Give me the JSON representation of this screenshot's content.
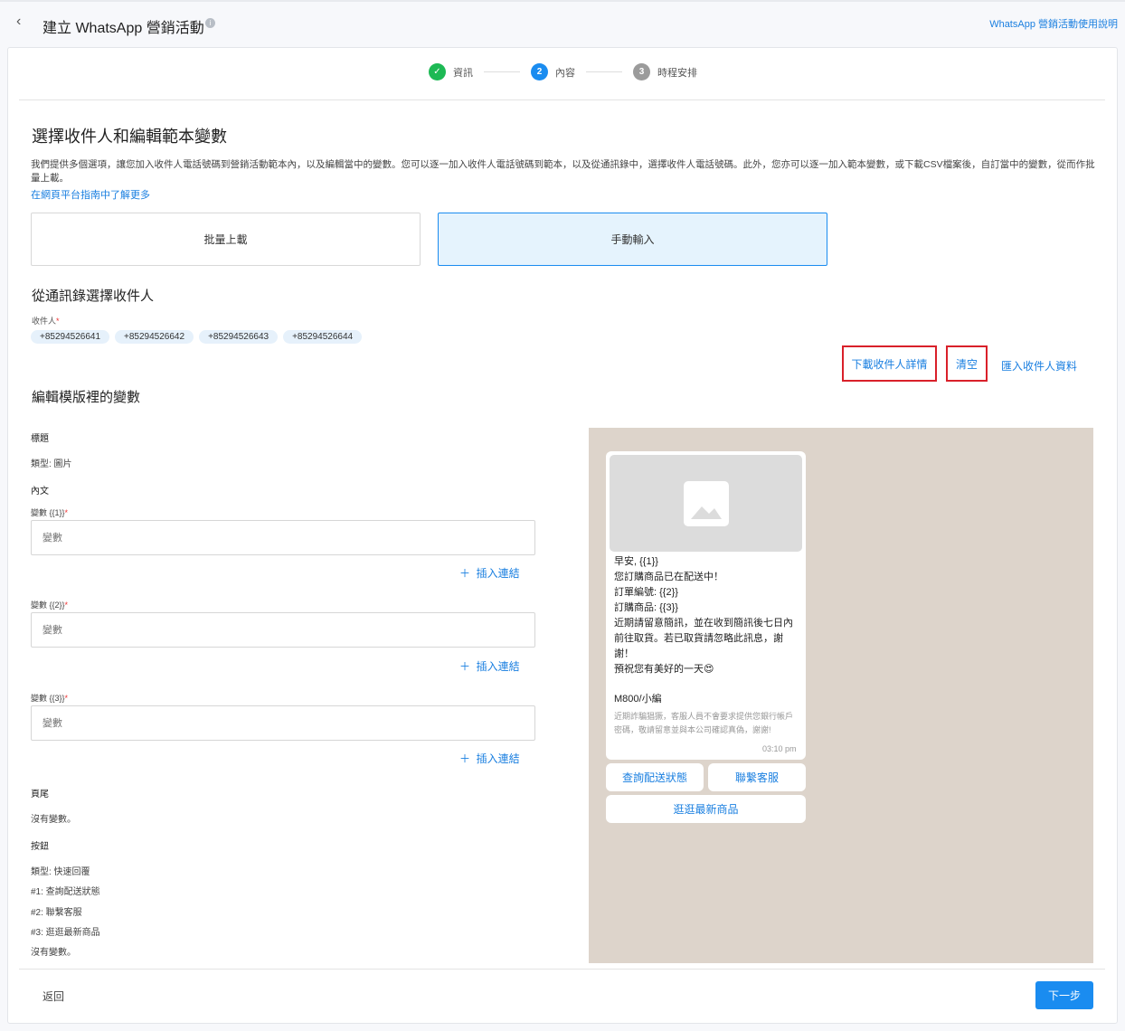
{
  "header": {
    "title": "建立 WhatsApp 營銷活動",
    "help_link": "WhatsApp 營銷活動使用說明"
  },
  "steps": [
    {
      "num": "✓",
      "label": "資訊",
      "color": "#1db954"
    },
    {
      "num": "2",
      "label": "內容",
      "color": "#1a8cf0"
    },
    {
      "num": "3",
      "label": "時程安排",
      "color": "#9b9b9b"
    }
  ],
  "section": {
    "title": "選擇收件人和編輯範本變數",
    "description": "我們提供多個選項，讓您加入收件人電話號碼到營銷活動範本內，以及編輯當中的變數。您可以逐一加入收件人電話號碼到範本，以及從通訊錄中，選擇收件人電話號碼。此外，您亦可以逐一加入範本變數，或下載CSV檔案後，自訂當中的變數，從而作批量上載。",
    "learn_more": "在網頁平台指南中了解更多"
  },
  "options": {
    "bulk": "批量上載",
    "manual": "手動輸入"
  },
  "recipients": {
    "title": "從通訊錄選擇收件人",
    "label": "收件人",
    "required": "*",
    "chips": [
      "+85294526641",
      "+85294526642",
      "+85294526643",
      "+85294526644"
    ],
    "download": "下載收件人詳情",
    "clear": "清空",
    "import": "匯入收件人資料"
  },
  "variables": {
    "title": "編輯模版裡的變數",
    "header_label": "標題",
    "header_type": "類型: 圖片",
    "body_label": "內文",
    "fields": [
      {
        "label": "變數 {{1}}",
        "placeholder": "變數"
      },
      {
        "label": "變數 {{2}}",
        "placeholder": "變數"
      },
      {
        "label": "變數 {{3}}",
        "placeholder": "變數"
      }
    ],
    "insert_link": "插入連結",
    "footer_label": "頁尾",
    "footer_none": "沒有變數。",
    "buttons_label": "按鈕",
    "buttons_type": "類型: 快速回覆",
    "button_items": [
      "#1: 查詢配送狀態",
      "#2: 聯繫客服",
      "#3: 逛逛最新商品"
    ],
    "buttons_none": "沒有變數。"
  },
  "preview": {
    "lines": [
      "早安, {{1}}",
      "您訂購商品已在配送中！",
      "訂單編號: {{2}}",
      "訂購商品: {{3}}",
      "近期請留意簡訊，並在收到簡訊後七日內前往取貨。若已取貨請忽略此訊息，謝謝！",
      "預祝您有美好的一天😍"
    ],
    "signature": "M800/小編",
    "footer": "近期詐騙猖獗，客服人員不會要求提供您銀行帳戶密碼，敬請留意並與本公司確認真偽，謝謝!",
    "time": "03:10 pm",
    "buttons": [
      "查詢配送狀態",
      "聯繫客服",
      "逛逛最新商品"
    ]
  },
  "footer": {
    "back": "返回",
    "next": "下一步"
  }
}
